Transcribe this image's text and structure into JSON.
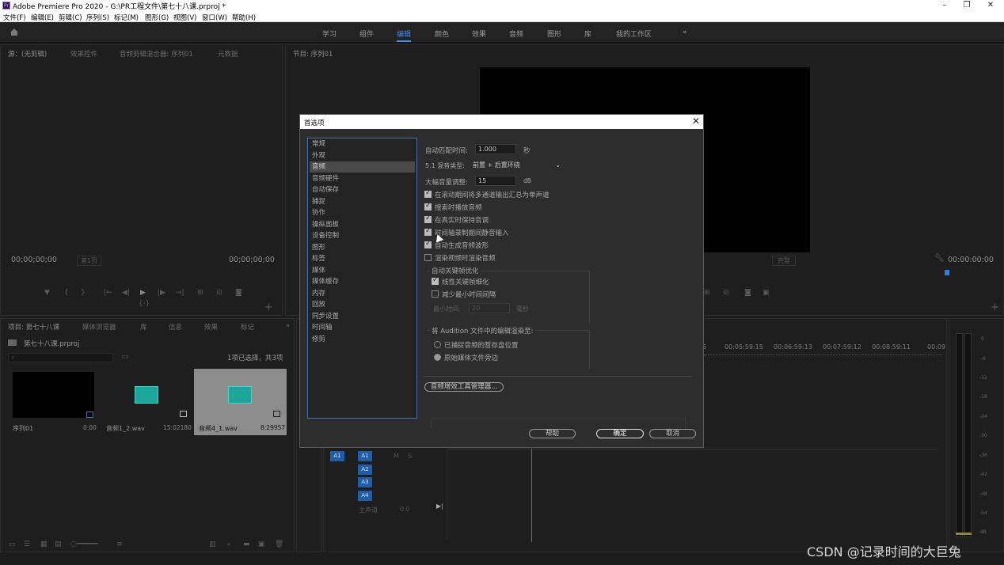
{
  "app": {
    "title": "Adobe Premiere Pro 2020 - G:\\PR工程文件\\第七十八课.prproj *",
    "icon": "premiere-icon"
  },
  "menu": [
    "文件(F)",
    "编辑(E)",
    "剪辑(C)",
    "序列(S)",
    "标记(M)",
    "图形(G)",
    "视图(V)",
    "窗口(W)",
    "帮助(H)"
  ],
  "workspaces": [
    "学习",
    "组件",
    "编辑",
    "颜色",
    "效果",
    "音频",
    "图形",
    "库",
    "我的工作区"
  ],
  "workspace_active": "编辑",
  "workspace_more": "»",
  "source_panel": {
    "tabs": [
      "源：(无剪辑)",
      "效果控件",
      "音频剪辑混合器: 序列01",
      "元数据"
    ],
    "timecode_left": "00;00;00;00",
    "page": "第1页",
    "timecode_right": "00;00;00;00"
  },
  "program_panel": {
    "tab": "节目: 序列01",
    "fit": "完整",
    "timecode": "00:00:00:00"
  },
  "project_panel": {
    "tabs": [
      "项目: 第七十八课",
      "媒体浏览器",
      "库",
      "信息",
      "效果",
      "标记"
    ],
    "project_name": "第七十八课.prproj",
    "selection": "1项已选择，共3项",
    "items": [
      {
        "name": "序列01",
        "duration": "0:00"
      },
      {
        "name": "音频1_2.wav",
        "duration": "15:02180"
      },
      {
        "name": "音频4_1.wav",
        "duration": "8:29957"
      }
    ]
  },
  "timeline": {
    "ruler": [
      "6",
      "00:05:59:15",
      "00:06:59:13",
      "00:07:59:12",
      "00:08:59:11",
      "00:09"
    ],
    "tracks": [
      "A1",
      "A2",
      "A3",
      "A4"
    ],
    "source_track": "A1",
    "master": "主声道",
    "master_val": "0.0",
    "m": "M",
    "s": "S"
  },
  "vu_scale": [
    "0",
    "-6",
    "-12",
    "-18",
    "-24",
    "-30",
    "-36",
    "-42",
    "-48",
    "-54",
    "dB"
  ],
  "dialog": {
    "title": "首选项",
    "categories": [
      "常规",
      "外观",
      "音频",
      "音频硬件",
      "自动保存",
      "捕捉",
      "协作",
      "操纵面板",
      "设备控制",
      "图形",
      "标签",
      "媒体",
      "媒体缓存",
      "内存",
      "回放",
      "同步设置",
      "时间轴",
      "修剪"
    ],
    "selected_category": "音频",
    "auto_match_label": "自动匹配时间:",
    "auto_match_value": "1.000",
    "auto_match_unit": "秒",
    "mix_label": "5.1 混音类型:",
    "mix_value": "前置 + 后置环绕",
    "nudge_label": "大幅音量调整:",
    "nudge_value": "15",
    "nudge_unit": "dB",
    "options": [
      {
        "label": "在滚动期间将多通道输出汇总为单声道",
        "checked": true
      },
      {
        "label": "搜索时播放音频",
        "checked": true
      },
      {
        "label": "在真实时保持音调",
        "checked": true
      },
      {
        "label": "时间轴录制期间静音输入",
        "checked": true
      },
      {
        "label": "自动生成音频波形",
        "checked": true
      },
      {
        "label": "渲染视频时渲染音频",
        "checked": false
      }
    ],
    "keyframe_group": "自动关键帧优化",
    "keyframe_options": [
      {
        "label": "线性关键帧细化",
        "checked": true
      },
      {
        "label": "减少最小时间间隔",
        "checked": false
      }
    ],
    "min_time_label": "最小时间:",
    "min_time_value": "20",
    "min_time_unit": "毫秒",
    "audition_group": "将 Audition 文件中的编辑渲染至:",
    "audition_options": [
      {
        "label": "已捕捉音频的暂存盘位置",
        "selected": false
      },
      {
        "label": "原始媒体文件旁边",
        "selected": true
      }
    ],
    "plugin_btn": "音频增效工具管理器...",
    "help_btn": "帮助",
    "ok_btn": "确定",
    "cancel_btn": "取消"
  },
  "watermark": "CSDN @记录时间的大巨兔"
}
